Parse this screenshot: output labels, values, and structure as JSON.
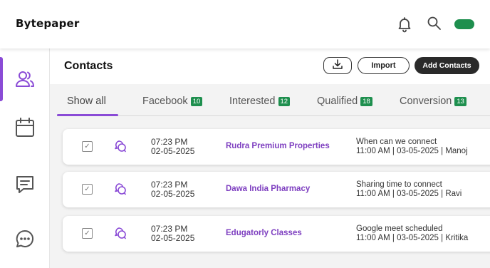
{
  "app": {
    "brand": "Bytepaper"
  },
  "colors": {
    "accent": "#8a4bd6",
    "badge_green": "#1e8f4e",
    "toggle_green": "#1e8f4e",
    "link_purple": "#7e3fc0"
  },
  "topbar": {
    "icons": [
      "bell-icon",
      "search-icon"
    ],
    "toggle_on": true
  },
  "sidebar": {
    "items": [
      {
        "icon": "users-icon",
        "active": true
      },
      {
        "icon": "calendar-icon",
        "active": false
      },
      {
        "icon": "message-square-icon",
        "active": false
      },
      {
        "icon": "chat-bubble-icon",
        "active": false
      }
    ]
  },
  "header": {
    "title": "Contacts",
    "import_label": "Import",
    "add_label": "Add Contacts"
  },
  "tabs": [
    {
      "label": "Show all",
      "count": null,
      "active": true
    },
    {
      "label": "Facebook",
      "count": "10"
    },
    {
      "label": "Interested",
      "count": "12"
    },
    {
      "label": "Qualified",
      "count": "18"
    },
    {
      "label": "Conversion",
      "count": "13"
    }
  ],
  "contacts": [
    {
      "time": "07:23 PM",
      "date": "02-05-2025",
      "company": "Rudra Premium Properties",
      "note": "When can we connect",
      "note_meta": "11:00 AM | 03-05-2025 | Manoj",
      "checked": true
    },
    {
      "time": "07:23 PM",
      "date": "02-05-2025",
      "company": "Dawa India Pharmacy",
      "note": "Sharing time to connect",
      "note_meta": "11:00 AM | 03-05-2025 | Ravi",
      "checked": true
    },
    {
      "time": "07:23 PM",
      "date": "02-05-2025",
      "company": "Edugatorly Classes",
      "note": "Google meet scheduled",
      "note_meta": "11:00 AM | 03-05-2025 | Kritika",
      "checked": true
    }
  ]
}
